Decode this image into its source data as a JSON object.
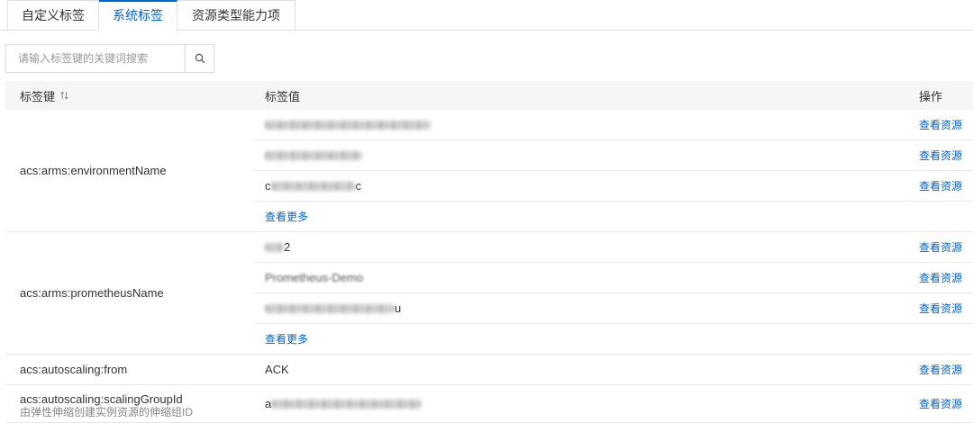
{
  "tabs": [
    {
      "label": "自定义标签"
    },
    {
      "label": "系统标签",
      "active": true
    },
    {
      "label": "资源类型能力项"
    }
  ],
  "search": {
    "placeholder": "请输入标签键的关键词搜索",
    "button_icon": "search-icon"
  },
  "table": {
    "columns": [
      "标签键",
      "标签值",
      "操作"
    ],
    "sort_icon": "sort-icon",
    "view_resources": "查看资源",
    "view_more": "查看更多",
    "rows": [
      {
        "key": "acs:arms:environmentName",
        "values": [
          {},
          {},
          {
            "lead": "c",
            "tail": "c"
          }
        ]
      },
      {
        "key": "acs:arms:prometheusName",
        "values": [
          {
            "tail": "2"
          },
          {
            "text": "Prometheus-Demo"
          },
          {
            "tail": "u"
          }
        ]
      },
      {
        "key": "acs:autoscaling:from",
        "values": [
          {
            "text": "ACK"
          }
        ]
      },
      {
        "key": "acs:autoscaling:scalingGroupId",
        "description": "由弹性伸缩创建实例资源的伸缩组ID",
        "values": [
          {
            "lead": "a"
          }
        ]
      }
    ]
  },
  "colors": {
    "accent": "#0064c8",
    "text": "#333333",
    "muted": "#888888",
    "placeholder": "#999999",
    "border": "#e8e8e8",
    "header_bg": "#f5f6f8"
  }
}
